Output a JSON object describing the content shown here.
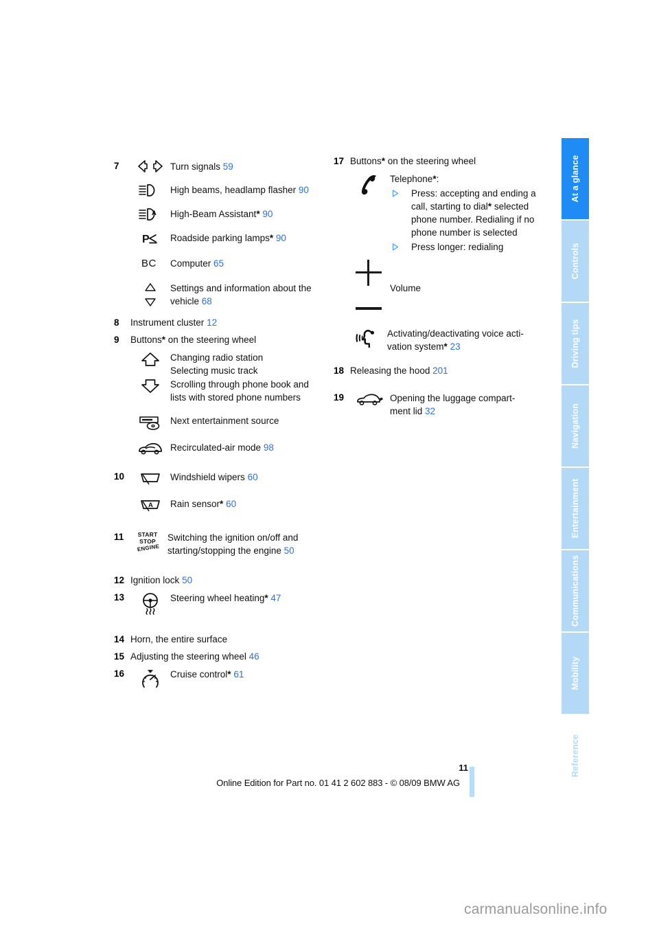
{
  "document": {
    "page_number": "11",
    "footer_text": "Online Edition for Part no. 01 41 2 602 883 - © 08/09 BMW AG",
    "watermark": "carmanualsonline.info",
    "accent_blue": "#2f6fe0",
    "tab_active_color": "#1f8cf5",
    "tab_inactive_color": "#b4d9f7"
  },
  "tabs": [
    {
      "label": "At a glance",
      "active": true
    },
    {
      "label": "Controls",
      "active": false
    },
    {
      "label": "Driving tips",
      "active": false
    },
    {
      "label": "Navigation",
      "active": false
    },
    {
      "label": "Entertainment",
      "active": false
    },
    {
      "label": "Communications",
      "active": false
    },
    {
      "label": "Mobility",
      "active": false
    },
    {
      "label": "Reference",
      "active": false
    }
  ],
  "left_column": {
    "item7": {
      "number": "7",
      "rows": [
        {
          "icon": "turn-signals-icon",
          "label": "Turn signals",
          "page": "59",
          "star": false
        },
        {
          "icon": "high-beams-icon",
          "label": "High beams, headlamp flasher",
          "page": "90",
          "star": false
        },
        {
          "icon": "high-beam-assistant-icon",
          "label": "High-Beam Assistant",
          "page": "90",
          "star": true
        },
        {
          "icon": "roadside-parking-lamps-icon",
          "label": "Roadside parking lamps",
          "page": "90",
          "star": true
        },
        {
          "icon": "computer-bc-icon",
          "label": "Computer",
          "page": "65",
          "star": false
        },
        {
          "icon": "up-down-arrows-icon",
          "label_line1": "Settings and information about the",
          "label_line2": "vehicle",
          "page": "68",
          "star": false
        }
      ]
    },
    "item8": {
      "number": "8",
      "label": "Instrument cluster",
      "page": "12"
    },
    "item9": {
      "number": "9",
      "label": "Buttons",
      "label_suffix": " on the steering wheel",
      "star": true,
      "rows": [
        {
          "icon": "up-arrow-icon",
          "lines": [
            "Changing radio station",
            "Selecting music track"
          ]
        },
        {
          "icon": "down-arrow-icon",
          "lines": [
            "Scrolling through phone book and",
            "lists with stored phone numbers"
          ]
        },
        {
          "icon": "entertainment-source-icon",
          "label": "Next entertainment source",
          "page": "",
          "star": false
        },
        {
          "icon": "recirculated-air-icon",
          "label": "Recirculated-air mode",
          "page": "98",
          "star": false
        }
      ]
    },
    "item10": {
      "number": "10",
      "rows": [
        {
          "icon": "windshield-wiper-icon",
          "label": "Windshield wipers",
          "page": "60",
          "star": false
        },
        {
          "icon": "rain-sensor-icon",
          "label": "Rain sensor",
          "page": "60",
          "star": true
        }
      ]
    },
    "item11": {
      "number": "11",
      "icon": "start-stop-engine-icon",
      "icon_text": {
        "start": "START",
        "stop": "STOP",
        "engine": "ENGINE"
      },
      "label_line1": "Switching the ignition on/off and",
      "label_line2": "starting/stopping the engine",
      "page": "50"
    },
    "item12": {
      "number": "12",
      "label": "Ignition lock",
      "page": "50"
    },
    "item13": {
      "number": "13",
      "icon": "steering-wheel-heating-icon",
      "label": "Steering wheel heating",
      "star": true,
      "page": "47"
    },
    "item14": {
      "number": "14",
      "label": "Horn, the entire surface"
    },
    "item15": {
      "number": "15",
      "label": "Adjusting the steering wheel",
      "page": "46"
    },
    "item16": {
      "number": "16",
      "icon": "cruise-control-icon",
      "label": "Cruise control",
      "star": true,
      "page": "61"
    }
  },
  "right_column": {
    "item17": {
      "number": "17",
      "label": "Buttons",
      "label_suffix": " on the steering wheel",
      "star": true,
      "telephone": {
        "icon": "telephone-handset-icon",
        "heading": "Telephone",
        "heading_star": true,
        "heading_suffix": ":",
        "bullets": [
          {
            "marker": "triangle-bullet-icon",
            "lines": [
              "Press: accepting and ending a",
              "call, starting to dial",
              " selected",
              "phone number. Redialing if no",
              "phone number is selected"
            ],
            "line2_star": true
          },
          {
            "marker": "triangle-bullet-icon",
            "lines": [
              "Press longer: redialing"
            ],
            "line2_star": false
          }
        ]
      },
      "volume": {
        "icon": "volume-plus-minus-icon",
        "label": "Volume"
      },
      "voice": {
        "icon": "voice-activation-icon",
        "label_line1": "Activating/deactivating voice acti-",
        "label_line2": "vation system",
        "star": true,
        "page": "23"
      }
    },
    "item18": {
      "number": "18",
      "label": "Releasing the hood",
      "page": "201"
    },
    "item19": {
      "number": "19",
      "icon": "luggage-compartment-icon",
      "label_line1": "Opening the luggage compart-",
      "label_line2": "ment lid",
      "page": "32"
    }
  }
}
